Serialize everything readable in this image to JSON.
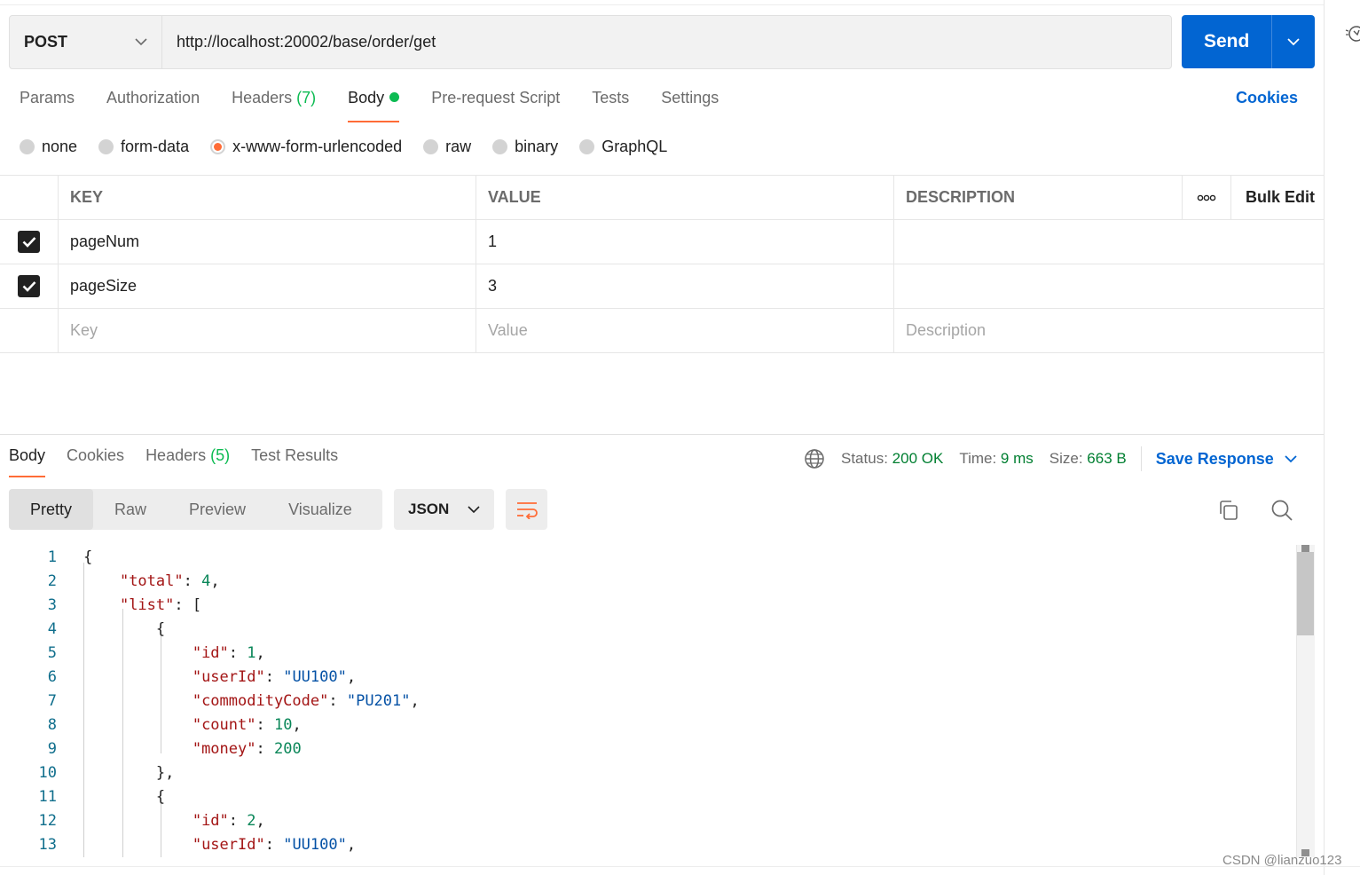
{
  "request": {
    "method": "POST",
    "url": "http://localhost:20002/base/order/get",
    "send_label": "Send"
  },
  "request_tabs": [
    {
      "label": "Params"
    },
    {
      "label": "Authorization"
    },
    {
      "label": "Headers",
      "count": "(7)"
    },
    {
      "label": "Body",
      "active": true
    },
    {
      "label": "Pre-request Script"
    },
    {
      "label": "Tests"
    },
    {
      "label": "Settings"
    }
  ],
  "cookies_label": "Cookies",
  "body_types": [
    "none",
    "form-data",
    "x-www-form-urlencoded",
    "raw",
    "binary",
    "GraphQL"
  ],
  "body_type_selected": "x-www-form-urlencoded",
  "params_table": {
    "headers": {
      "key": "KEY",
      "value": "VALUE",
      "description": "DESCRIPTION",
      "bulk_edit": "Bulk Edit"
    },
    "rows": [
      {
        "checked": true,
        "key": "pageNum",
        "value": "1",
        "description": ""
      },
      {
        "checked": true,
        "key": "pageSize",
        "value": "3",
        "description": ""
      }
    ],
    "placeholders": {
      "key": "Key",
      "value": "Value",
      "description": "Description"
    }
  },
  "response": {
    "tabs": [
      {
        "label": "Body",
        "active": true
      },
      {
        "label": "Cookies"
      },
      {
        "label": "Headers",
        "count": "(5)"
      },
      {
        "label": "Test Results"
      }
    ],
    "status_label": "Status:",
    "status_value": "200 OK",
    "time_label": "Time:",
    "time_value": "9 ms",
    "size_label": "Size:",
    "size_value": "663 B",
    "save_label": "Save Response",
    "views": [
      "Pretty",
      "Raw",
      "Preview",
      "Visualize"
    ],
    "active_view": "Pretty",
    "format": "JSON"
  },
  "code_lines": [
    "{",
    "    \"total\": 4,",
    "    \"list\": [",
    "        {",
    "            \"id\": 1,",
    "            \"userId\": \"UU100\",",
    "            \"commodityCode\": \"PU201\",",
    "            \"count\": 10,",
    "            \"money\": 200",
    "        },",
    "        {",
    "            \"id\": 2,",
    "            \"userId\": \"UU100\","
  ],
  "watermark": "CSDN @lianzuo123",
  "colors": {
    "accent": "#ff6c37",
    "primary": "#0265d2",
    "success": "#007f31"
  }
}
